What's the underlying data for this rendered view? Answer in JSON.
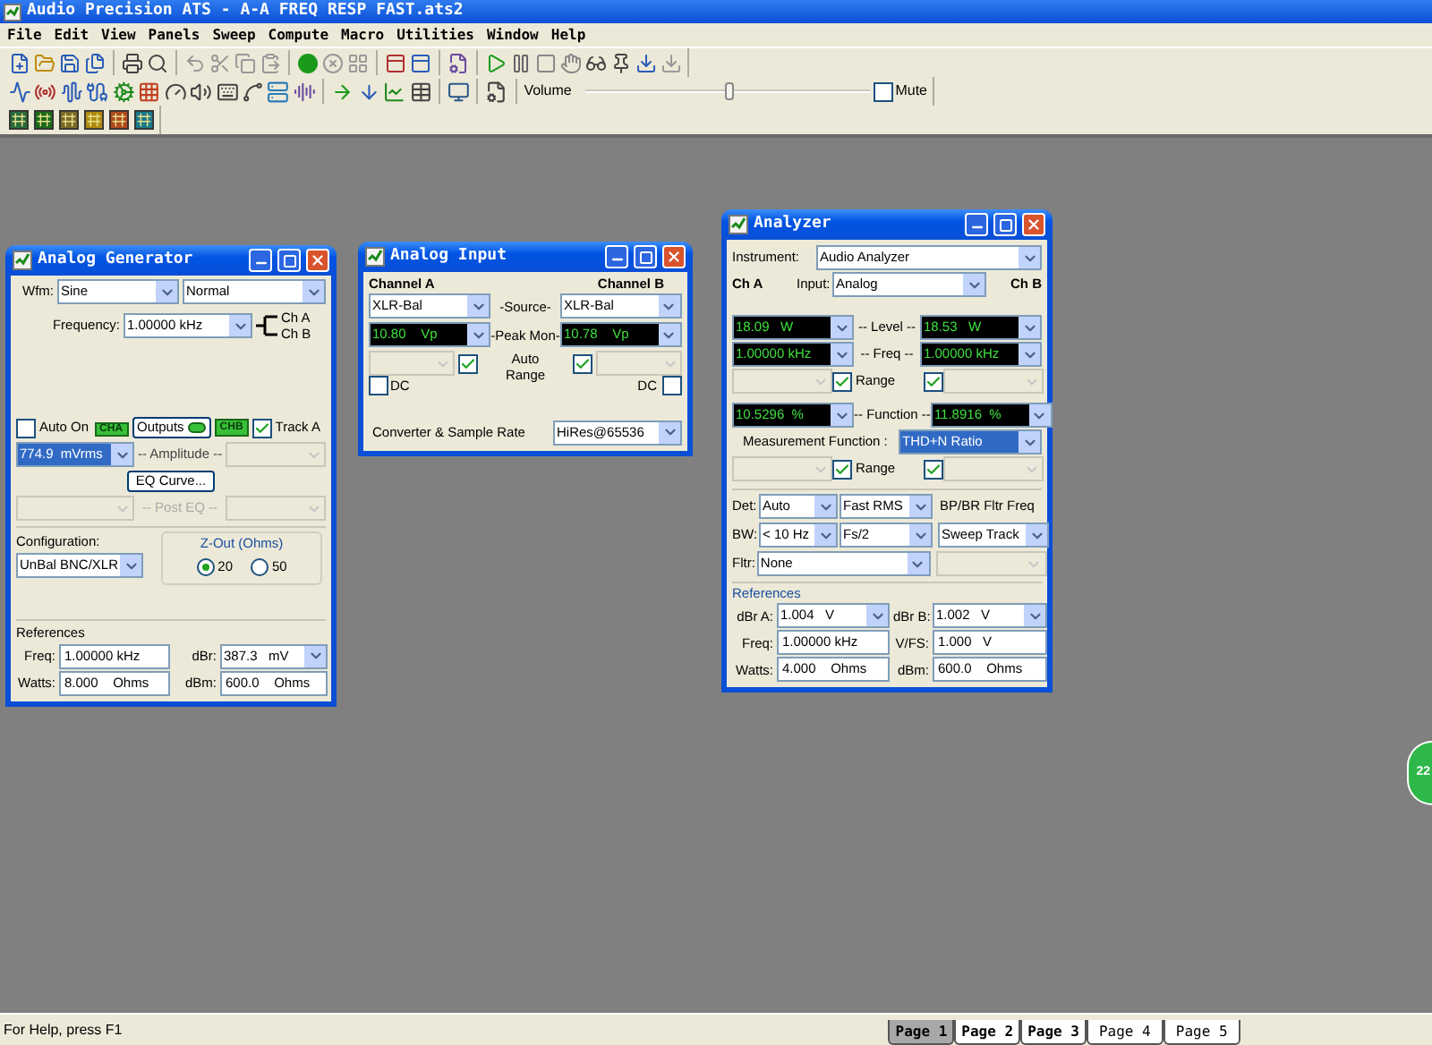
{
  "window": {
    "title": "Audio Precision ATS - A-A FREQ RESP FAST.ats2"
  },
  "menu": [
    "File",
    "Edit",
    "View",
    "Panels",
    "Sweep",
    "Compute",
    "Macro",
    "Utilities",
    "Window",
    "Help"
  ],
  "toolbar": {
    "volume_label": "Volume",
    "volume": {
      "level": 0.5
    },
    "mute": {
      "label": "Mute",
      "checked": false
    }
  },
  "generator": {
    "title": "Analog Generator",
    "wfm_label": "Wfm:",
    "waveform": "Sine",
    "mode": "Normal",
    "frequency_label": "Frequency:",
    "frequency": "1.00000 kHz",
    "ch_a": "Ch A",
    "ch_b": "Ch B",
    "auto_on": {
      "label": "Auto On",
      "checked": false
    },
    "cha_badge": "CHA",
    "outputs_button": "Outputs",
    "chb_badge": "CHB",
    "track_a": {
      "label": "Track A",
      "checked": true
    },
    "amplitude": "774.9  mVrms",
    "amplitude_label": "-- Amplitude --",
    "eq_button": "EQ Curve...",
    "post_eq_label": "-- Post EQ --",
    "configuration_label": "Configuration:",
    "configuration": "UnBal BNC/XLR",
    "zout_label": "Z-Out (Ohms)",
    "zout_options": [
      {
        "label": "20",
        "selected": true
      },
      {
        "label": "50",
        "selected": false
      }
    ],
    "references_label": "References",
    "refs": [
      {
        "label": "Freq:",
        "value": "1.00000 kHz",
        "kind": "text"
      },
      {
        "label": "dBr:",
        "value": "387.3   mV",
        "kind": "select"
      },
      {
        "label": "Watts:",
        "value": "8.000    Ohms",
        "kind": "text"
      },
      {
        "label": "dBm:",
        "value": "600.0    Ohms",
        "kind": "text"
      }
    ]
  },
  "input": {
    "title": "Analog Input",
    "channel_a": "Channel A",
    "channel_b": "Channel B",
    "source_label": "-Source-",
    "source_a": "XLR-Bal",
    "source_b": "XLR-Bal",
    "peak_label": "-Peak Mon-",
    "peak_a": "10.80    Vp",
    "peak_b": "10.78    Vp",
    "auto_range_a": {
      "checked": true
    },
    "auto_range_label": "Auto Range",
    "auto_range_b": {
      "checked": true
    },
    "dc_a": {
      "label": "DC",
      "checked": false
    },
    "dc_b": {
      "label": "DC",
      "checked": false
    },
    "converter_label": "Converter & Sample Rate",
    "converter": "HiRes@65536"
  },
  "analyzer": {
    "title": "Analyzer",
    "instrument_label": "Instrument:",
    "instrument": "Audio Analyzer",
    "ch_a": "Ch A",
    "input_label": "Input:",
    "input": "Analog",
    "ch_b": "Ch B",
    "level": {
      "a": "18.09   W",
      "label": "-- Level --",
      "b": "18.53   W"
    },
    "freq": {
      "a": "1.00000 kHz",
      "label": "-- Freq --",
      "b": "1.00000 kHz"
    },
    "range_1": {
      "label": "Range",
      "a_checked": true,
      "b_checked": true
    },
    "function": {
      "a": "10.5296  %",
      "label": "-- Function --",
      "b": "11.8916  %"
    },
    "measurement_label": "Measurement Function :",
    "measurement": "THD+N Ratio",
    "range_2": {
      "label": "Range",
      "a_checked": true,
      "b_checked": true
    },
    "det_label": "Det:",
    "det": "Auto",
    "det_mode": "Fast RMS",
    "bp_label": "BP/BR Fltr Freq",
    "bw_label": "BW:",
    "bw": "< 10 Hz",
    "bw_high": "Fs/2",
    "bp_value": "Sweep Track",
    "fltr_label": "Fltr:",
    "fltr": "None",
    "references_label": "References",
    "refs": [
      {
        "label": "dBr A:",
        "value": "1.004   V",
        "kind": "select"
      },
      {
        "label": "dBr B:",
        "value": "1.002   V",
        "kind": "select"
      },
      {
        "label": "Freq:",
        "value": "1.00000 kHz",
        "kind": "text"
      },
      {
        "label": "V/FS:",
        "value": "1.000   V",
        "kind": "text"
      },
      {
        "label": "Watts:",
        "value": "4.000    Ohms",
        "kind": "text"
      },
      {
        "label": "dBm:",
        "value": "600.0    Ohms",
        "kind": "text"
      }
    ]
  },
  "badge": "22",
  "status_bar": {
    "text": "For Help, press F1",
    "pages": [
      {
        "label": "Page 1",
        "selected": true,
        "bold": true
      },
      {
        "label": "Page 2",
        "selected": false,
        "bold": true
      },
      {
        "label": "Page 3",
        "selected": false,
        "bold": true
      },
      {
        "label": "Page 4",
        "selected": false,
        "bold": false
      },
      {
        "label": "Page 5",
        "selected": false,
        "bold": false
      }
    ]
  }
}
